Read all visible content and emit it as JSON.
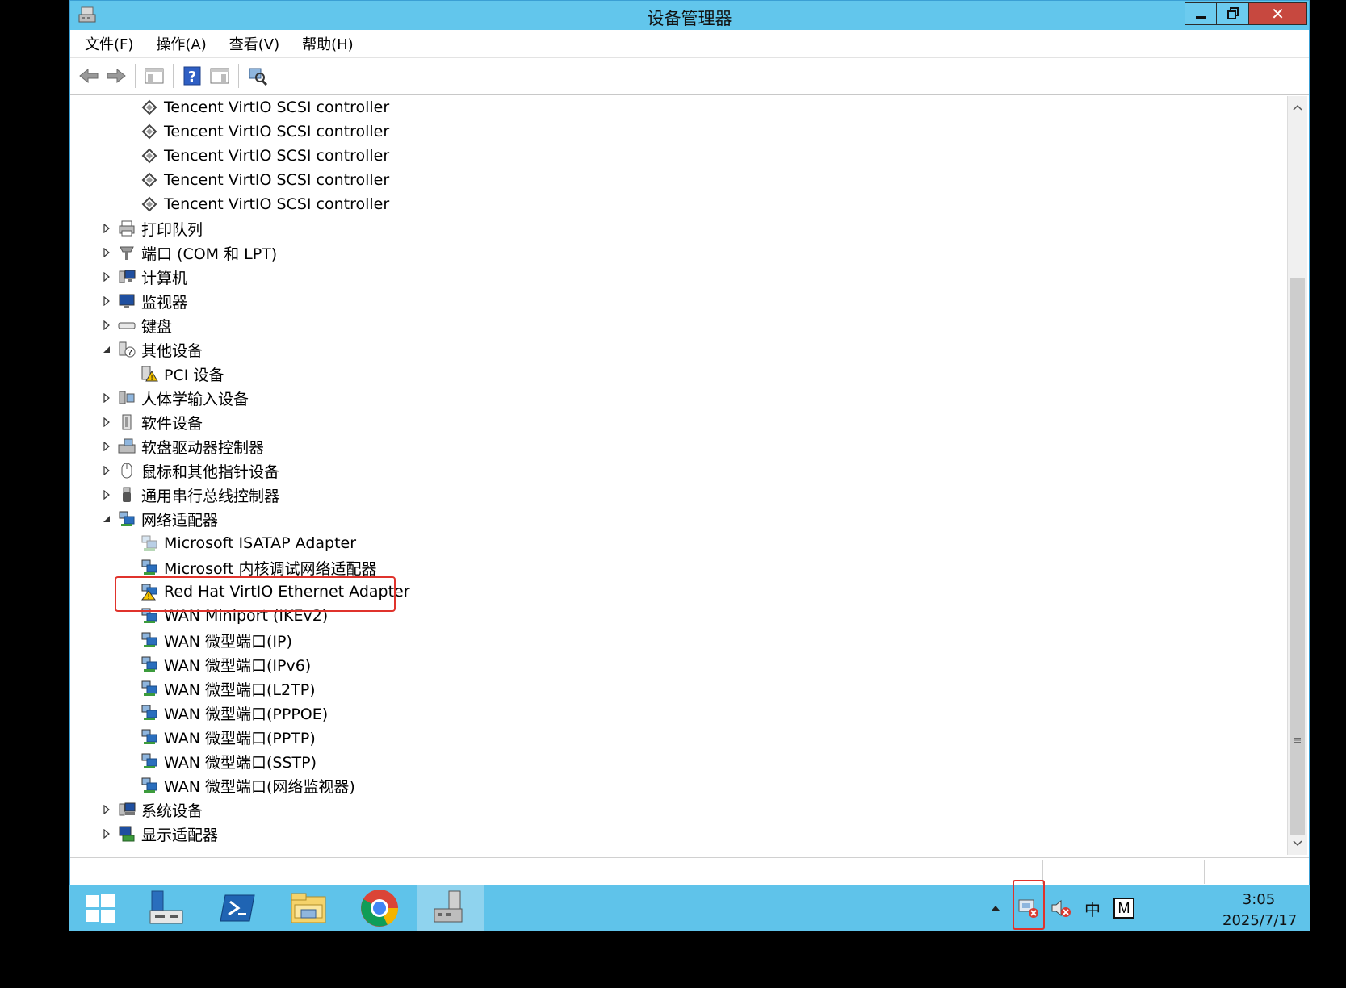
{
  "window": {
    "title": "设备管理器",
    "close_glyph": "✕"
  },
  "menu": [
    "文件(F)",
    "操作(A)",
    "查看(V)",
    "帮助(H)"
  ],
  "tree_items": [
    {
      "label": "Tencent VirtIO SCSI controller",
      "level": 2,
      "icon": "storage-controller-icon",
      "arrow": "none"
    },
    {
      "label": "Tencent VirtIO SCSI controller",
      "level": 2,
      "icon": "storage-controller-icon",
      "arrow": "none"
    },
    {
      "label": "Tencent VirtIO SCSI controller",
      "level": 2,
      "icon": "storage-controller-icon",
      "arrow": "none"
    },
    {
      "label": "Tencent VirtIO SCSI controller",
      "level": 2,
      "icon": "storage-controller-icon",
      "arrow": "none"
    },
    {
      "label": "Tencent VirtIO SCSI controller",
      "level": 2,
      "icon": "storage-controller-icon",
      "arrow": "none"
    },
    {
      "label": "打印队列",
      "level": 1,
      "icon": "printer-icon",
      "arrow": "collapsed"
    },
    {
      "label": "端口 (COM 和 LPT)",
      "level": 1,
      "icon": "port-icon",
      "arrow": "collapsed"
    },
    {
      "label": "计算机",
      "level": 1,
      "icon": "computer-icon",
      "arrow": "collapsed"
    },
    {
      "label": "监视器",
      "level": 1,
      "icon": "monitor-icon",
      "arrow": "collapsed"
    },
    {
      "label": "键盘",
      "level": 1,
      "icon": "keyboard-icon",
      "arrow": "collapsed"
    },
    {
      "label": "其他设备",
      "level": 1,
      "icon": "unknown-device-icon",
      "arrow": "expanded"
    },
    {
      "label": "PCI 设备",
      "level": 2,
      "icon": "warning-device-icon",
      "arrow": "none"
    },
    {
      "label": "人体学输入设备",
      "level": 1,
      "icon": "hid-icon",
      "arrow": "collapsed"
    },
    {
      "label": "软件设备",
      "level": 1,
      "icon": "software-device-icon",
      "arrow": "collapsed"
    },
    {
      "label": "软盘驱动器控制器",
      "level": 1,
      "icon": "floppy-controller-icon",
      "arrow": "collapsed"
    },
    {
      "label": "鼠标和其他指针设备",
      "level": 1,
      "icon": "mouse-icon",
      "arrow": "collapsed"
    },
    {
      "label": "通用串行总线控制器",
      "level": 1,
      "icon": "usb-icon",
      "arrow": "collapsed"
    },
    {
      "label": "网络适配器",
      "level": 1,
      "icon": "network-adapter-icon",
      "arrow": "expanded"
    },
    {
      "label": "Microsoft ISATAP Adapter",
      "level": 2,
      "icon": "network-adapter-disabled-icon",
      "arrow": "none"
    },
    {
      "label": "Microsoft 内核调试网络适配器",
      "level": 2,
      "icon": "network-adapter-icon",
      "arrow": "none"
    },
    {
      "label": "Red Hat VirtIO Ethernet Adapter",
      "level": 2,
      "icon": "network-adapter-warning-icon",
      "arrow": "none",
      "highlight": true
    },
    {
      "label": "WAN Miniport (IKEv2)",
      "level": 2,
      "icon": "network-adapter-icon",
      "arrow": "none"
    },
    {
      "label": "WAN 微型端口(IP)",
      "level": 2,
      "icon": "network-adapter-icon",
      "arrow": "none"
    },
    {
      "label": "WAN 微型端口(IPv6)",
      "level": 2,
      "icon": "network-adapter-icon",
      "arrow": "none"
    },
    {
      "label": "WAN 微型端口(L2TP)",
      "level": 2,
      "icon": "network-adapter-icon",
      "arrow": "none"
    },
    {
      "label": "WAN 微型端口(PPPOE)",
      "level": 2,
      "icon": "network-adapter-icon",
      "arrow": "none"
    },
    {
      "label": "WAN 微型端口(PPTP)",
      "level": 2,
      "icon": "network-adapter-icon",
      "arrow": "none"
    },
    {
      "label": "WAN 微型端口(SSTP)",
      "level": 2,
      "icon": "network-adapter-icon",
      "arrow": "none"
    },
    {
      "label": "WAN 微型端口(网络监视器)",
      "level": 2,
      "icon": "network-adapter-icon",
      "arrow": "none"
    },
    {
      "label": "系统设备",
      "level": 1,
      "icon": "system-device-icon",
      "arrow": "collapsed"
    },
    {
      "label": "显示适配器",
      "level": 1,
      "icon": "display-adapter-icon",
      "arrow": "collapsed"
    }
  ],
  "taskbar": {
    "apps": [
      "start-button",
      "server-manager",
      "powershell",
      "file-explorer",
      "chrome",
      "device-manager"
    ],
    "tray_ime": "中",
    "tray_m": "M",
    "time": "3:05",
    "date": "2025/7/17"
  },
  "colors": {
    "titlebar": "#62c6ec",
    "taskbar": "#5fc3ea",
    "highlight_border": "#e0332c"
  }
}
